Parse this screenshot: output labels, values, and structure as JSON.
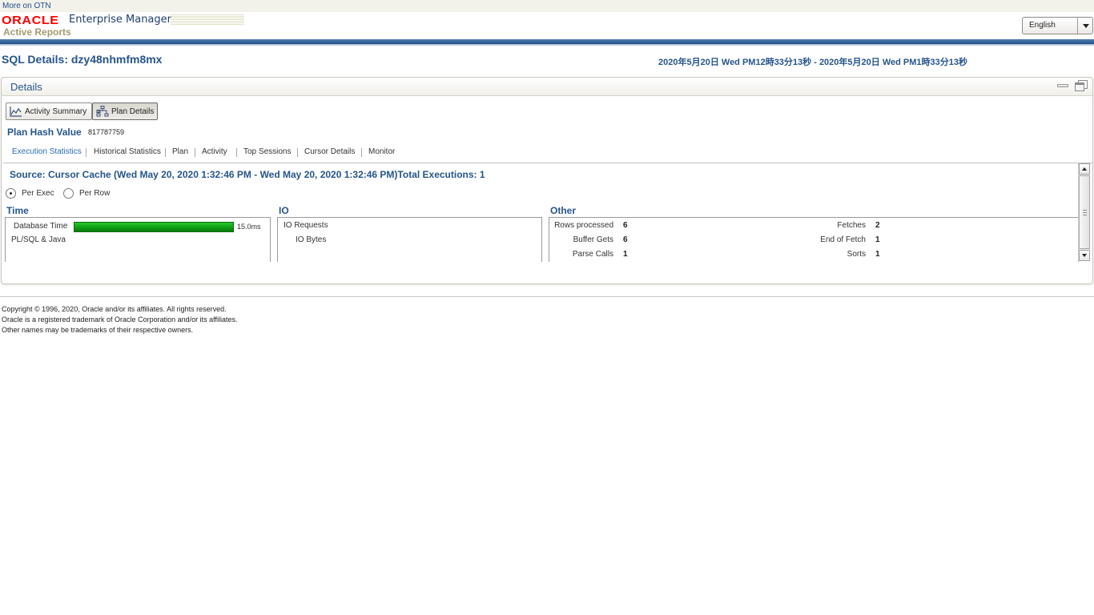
{
  "topbar": {
    "otn_link": "More on OTN"
  },
  "brand": {
    "logo": "ORACLE",
    "product": "Enterprise Manager",
    "subtitle": "Active Reports"
  },
  "language": {
    "selected": "English"
  },
  "page": {
    "title": "SQL Details: dzy48nhmfm8mx",
    "time_range": "2020年5月20日 Wed PM12時33分13秒 - 2020年5月20日 Wed PM1時33分13秒"
  },
  "panel": {
    "title": "Details",
    "buttons": {
      "activity_summary": "Activity Summary",
      "plan_details": "Plan Details"
    },
    "plan_hash_label": "Plan Hash Value",
    "plan_hash_value": "817787759",
    "subnav": [
      "Execution Statistics",
      "Historical Statistics",
      "Plan",
      "Activity",
      "Top Sessions",
      "Cursor Details",
      "Monitor"
    ],
    "source_line": "Source: Cursor Cache (Wed May 20, 2020 1:32:46 PM - Wed May 20, 2020 1:32:46 PM)Total Executions: 1",
    "radios": {
      "per_exec": "Per Exec",
      "per_row": "Per Row",
      "selected": "Per Exec"
    },
    "time": {
      "title": "Time",
      "database_time_label": "Database Time",
      "database_time_value": "15.0ms",
      "plsql_label": "PL/SQL & Java"
    },
    "io": {
      "title": "IO",
      "requests_label": "IO Requests",
      "bytes_label": "IO Bytes"
    },
    "other": {
      "title": "Other",
      "rows_processed_label": "Rows processed",
      "rows_processed": "6",
      "buffer_gets_label": "Buffer Gets",
      "buffer_gets": "6",
      "parse_calls_label": "Parse Calls",
      "parse_calls": "1",
      "fetches_label": "Fetches",
      "fetches": "2",
      "end_of_fetch_label": "End of Fetch",
      "end_of_fetch": "1",
      "sorts_label": "Sorts",
      "sorts": "1"
    }
  },
  "footer": {
    "line1": "Copyright © 1996, 2020, Oracle and/or its affiliates. All rights reserved.",
    "line2": "Oracle is a registered trademark of Oracle Corporation and/or its affiliates.",
    "line3": "Other names may be trademarks of their respective owners."
  },
  "colors": {
    "brand_red": "#ff0000",
    "heading_blue": "#26558b",
    "link_blue": "#2a6cb3",
    "bar_green": "#0e9a12"
  },
  "icons": {
    "activity_summary": "area-chart-icon",
    "plan_details": "tree-diagram-icon"
  }
}
